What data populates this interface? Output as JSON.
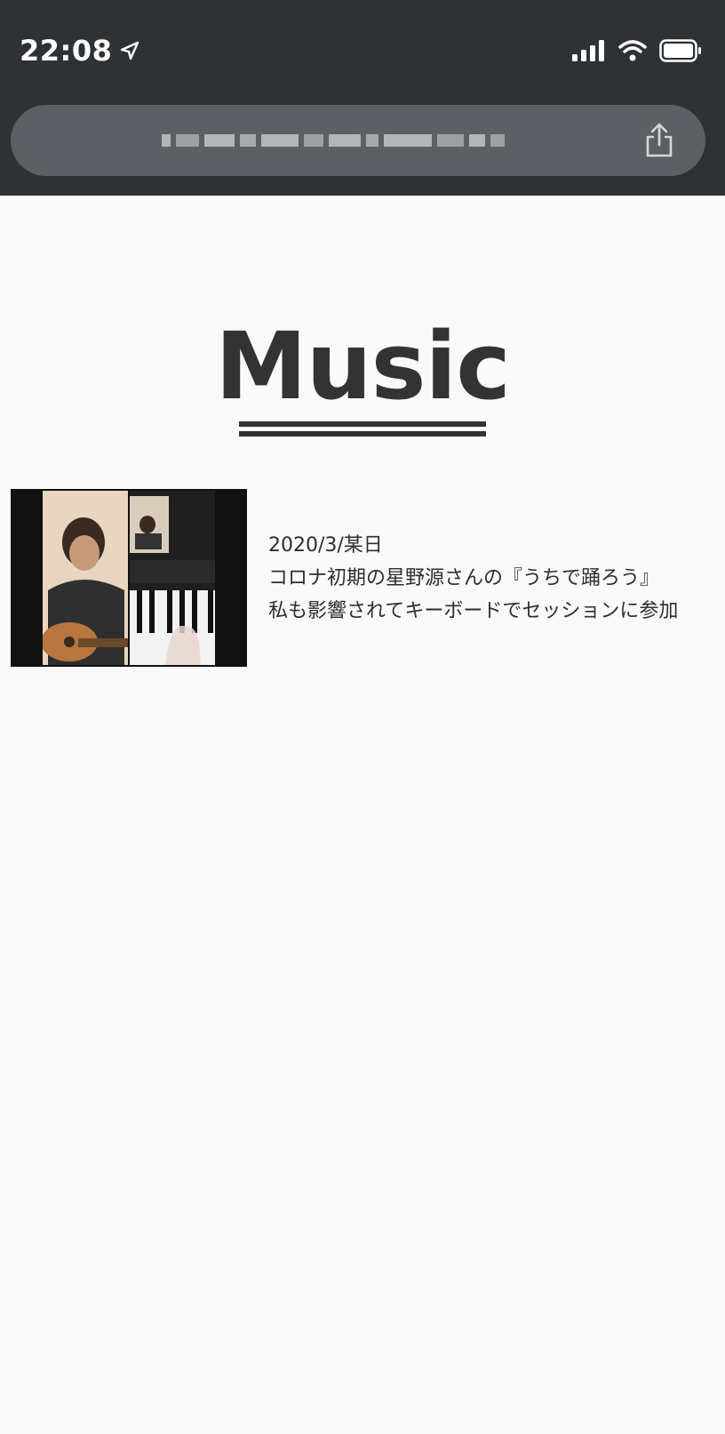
{
  "status_bar": {
    "time": "22:08"
  },
  "browser": {
    "url_text_obscured": true,
    "share_icon": "share-icon"
  },
  "page": {
    "title": "Music",
    "entries": [
      {
        "thumbnail_icon": "video-thumbnail",
        "date": "2020/3/某日",
        "line1": "コロナ初期の星野源さんの『うちで踊ろう』",
        "line2": "私も影響されてキーボードでセッションに参加"
      }
    ]
  },
  "colors": {
    "chrome_bg": "#2f3235",
    "url_bar_bg": "#5c5f63",
    "page_bg": "#fafafa",
    "heading_text": "#333333"
  }
}
